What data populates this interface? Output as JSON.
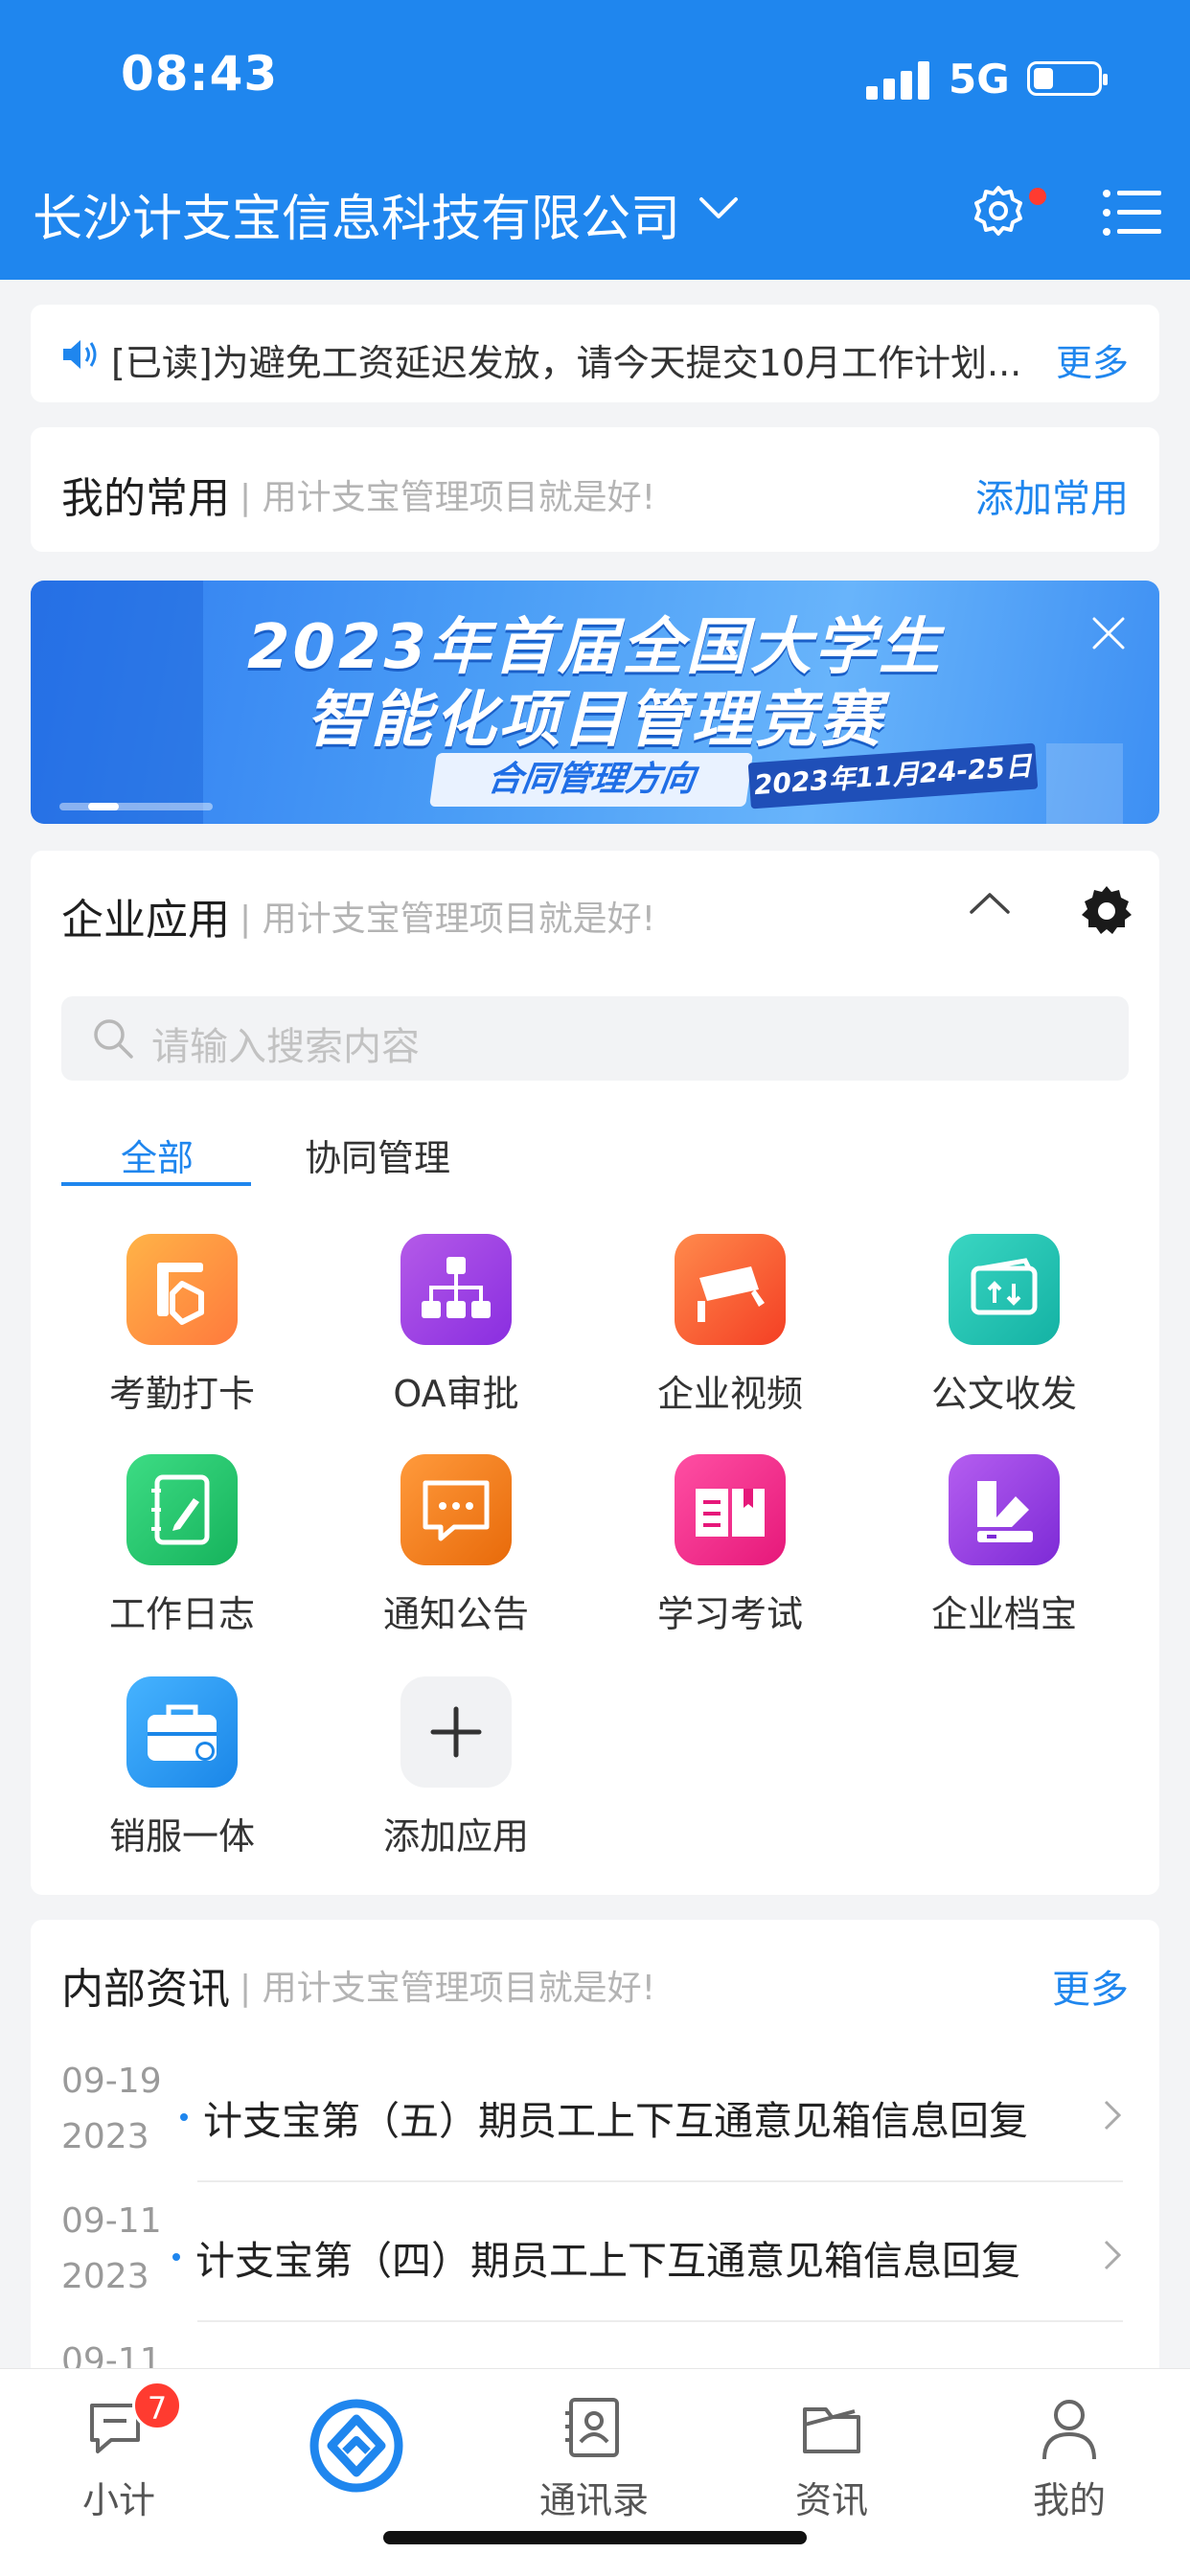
{
  "status_bar": {
    "time": "08:43",
    "network": "5G"
  },
  "header": {
    "company": "长沙计支宝信息科技有限公司"
  },
  "notice": {
    "text": "[已读]为避免工资延迟发放，请今天提交10月工作计划...",
    "more": "更多"
  },
  "favorites": {
    "title": "我的常用",
    "subtitle": "| 用计支宝管理项目就是好!",
    "action": "添加常用"
  },
  "banner": {
    "line1": "2023年首届全国大学生",
    "line2": "智能化项目管理竞赛",
    "tag": "合同管理方向",
    "date": "2023年11月24-25日"
  },
  "enterprise": {
    "title": "企业应用",
    "subtitle": "| 用计支宝管理项目就是好!",
    "search_placeholder": "请输入搜索内容",
    "tabs": [
      "全部",
      "协同管理"
    ],
    "apps": [
      {
        "label": "考勤打卡",
        "icon": "attendance-icon"
      },
      {
        "label": "OA审批",
        "icon": "approval-icon"
      },
      {
        "label": "企业视频",
        "icon": "camera-icon"
      },
      {
        "label": "公文收发",
        "icon": "document-transfer-icon"
      },
      {
        "label": "工作日志",
        "icon": "work-log-icon"
      },
      {
        "label": "通知公告",
        "icon": "announcement-icon"
      },
      {
        "label": "学习考试",
        "icon": "study-icon"
      },
      {
        "label": "企业档宝",
        "icon": "archive-icon"
      },
      {
        "label": "销服一体",
        "icon": "briefcase-icon"
      },
      {
        "label": "添加应用",
        "icon": "add-icon"
      }
    ]
  },
  "news": {
    "title": "内部资讯",
    "subtitle": "| 用计支宝管理项目就是好!",
    "more": "更多",
    "items": [
      {
        "date": "09-19",
        "year": "2023",
        "title": "计支宝第（五）期员工上下互通意见箱信息回复"
      },
      {
        "date": "09-11",
        "year": "2023",
        "title": "计支宝第（四）期员工上下互通意见箱信息回复"
      },
      {
        "date": "09-11",
        "year": "",
        "title": ""
      }
    ]
  },
  "tabbar": {
    "items": [
      "小计",
      "",
      "通讯录",
      "资讯",
      "我的"
    ],
    "badge": "7"
  },
  "colors": {
    "primary": "#1f86ee",
    "badge": "#ff3b30"
  }
}
